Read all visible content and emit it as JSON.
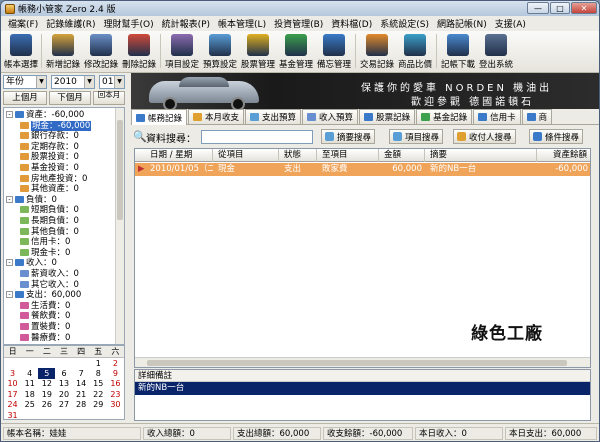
{
  "window": {
    "title": "帳務小管家 Zero 2.4 版"
  },
  "menu": [
    "檔案(F)",
    "記錄維護(R)",
    "理財幫手(O)",
    "統計報表(P)",
    "帳本管理(L)",
    "投資管理(B)",
    "資料檔(D)",
    "系統設定(S)",
    "網路記帳(N)",
    "支援(A)"
  ],
  "toolbar": [
    {
      "label": "帳本選擇",
      "icon": "ledger-icon",
      "color": "#3b6db3"
    },
    {
      "label": "新增記錄",
      "icon": "new-record-icon",
      "color": "#d6a33a"
    },
    {
      "label": "修改記錄",
      "icon": "edit-record-icon",
      "color": "#6a8fc7"
    },
    {
      "label": "刪除記錄",
      "icon": "delete-record-icon",
      "color": "#d04a3a"
    },
    {
      "label": "項目設定",
      "icon": "item-settings-icon",
      "color": "#8c6bb0"
    },
    {
      "label": "預算設定",
      "icon": "budget-settings-icon",
      "color": "#5a9ed6"
    },
    {
      "label": "股票管理",
      "icon": "stock-icon",
      "color": "#e0b020"
    },
    {
      "label": "基金管理",
      "icon": "fund-icon",
      "color": "#3ca04c"
    },
    {
      "label": "備忘管理",
      "icon": "memo-icon",
      "color": "#3a7ac8"
    },
    {
      "label": "交易記錄",
      "icon": "pencil-icon",
      "color": "#e38a2a"
    },
    {
      "label": "商品比價",
      "icon": "compare-icon",
      "color": "#3aa0c8"
    },
    {
      "label": "記帳下載",
      "icon": "download-icon",
      "color": "#4a8ad0"
    },
    {
      "label": "登出系統",
      "icon": "logout-icon",
      "color": "#5a7090"
    }
  ],
  "nav": {
    "year_label": "年份",
    "year": "2010",
    "month": "01",
    "prev_month": "上個月",
    "next_month": "下個月",
    "this_month": "回本月"
  },
  "tree": [
    {
      "text": "資產：-60,000",
      "level": 0,
      "expand": "-",
      "color": "#3a7ac8"
    },
    {
      "text": "現金：-60,000",
      "level": 1,
      "color": "#e09a3a",
      "selected": true
    },
    {
      "text": "銀行存款：0",
      "level": 1,
      "color": "#e09a3a"
    },
    {
      "text": "定期存款：0",
      "level": 1,
      "color": "#e09a3a"
    },
    {
      "text": "股票投資：0",
      "level": 1,
      "color": "#e09a3a"
    },
    {
      "text": "基金投資：0",
      "level": 1,
      "color": "#e09a3a"
    },
    {
      "text": "房地產投資：0",
      "level": 1,
      "color": "#e09a3a"
    },
    {
      "text": "其他資產：0",
      "level": 1,
      "color": "#e09a3a"
    },
    {
      "text": "負債：0",
      "level": 0,
      "expand": "-",
      "color": "#3a7ac8"
    },
    {
      "text": "短期負債：0",
      "level": 1,
      "color": "#7cb85a"
    },
    {
      "text": "長期負債：0",
      "level": 1,
      "color": "#7cb85a"
    },
    {
      "text": "其他負債：0",
      "level": 1,
      "color": "#7cb85a"
    },
    {
      "text": "信用卡：0",
      "level": 1,
      "color": "#7cb85a"
    },
    {
      "text": "現金卡：0",
      "level": 1,
      "color": "#7cb85a"
    },
    {
      "text": "收入：0",
      "level": 0,
      "expand": "-",
      "color": "#3a7ac8"
    },
    {
      "text": "薪資收入：0",
      "level": 1,
      "color": "#6a8fd0"
    },
    {
      "text": "其它收入：0",
      "level": 1,
      "color": "#6a8fd0"
    },
    {
      "text": "支出：60,000",
      "level": 0,
      "expand": "-",
      "color": "#3a7ac8"
    },
    {
      "text": "生活費：0",
      "level": 1,
      "color": "#d05a9a"
    },
    {
      "text": "餐飲費：0",
      "level": 1,
      "color": "#d05a9a"
    },
    {
      "text": "置裝費：0",
      "level": 1,
      "color": "#d05a9a"
    },
    {
      "text": "醫療費：0",
      "level": 1,
      "color": "#d05a9a"
    }
  ],
  "calendar": {
    "weekdays": [
      "日",
      "一",
      "二",
      "三",
      "四",
      "五",
      "六"
    ],
    "weeks": [
      [
        "",
        "",
        "",
        "",
        "",
        "1",
        "2"
      ],
      [
        "3",
        "4",
        "5",
        "6",
        "7",
        "8",
        "9"
      ],
      [
        "10",
        "11",
        "12",
        "13",
        "14",
        "15",
        "16"
      ],
      [
        "17",
        "18",
        "19",
        "20",
        "21",
        "22",
        "23"
      ],
      [
        "24",
        "25",
        "26",
        "27",
        "28",
        "29",
        "30"
      ],
      [
        "31",
        "",
        "",
        "",
        "",
        "",
        ""
      ]
    ],
    "today": "5"
  },
  "banner": {
    "line1": "保護你的愛車 NORDEN 機油出",
    "line2": "歡迎參觀 德國諾頓石"
  },
  "tabs": [
    {
      "label": "帳務記錄",
      "color": "#3a7ac8",
      "active": true
    },
    {
      "label": "本月收支",
      "color": "#e0a030"
    },
    {
      "label": "支出預算",
      "color": "#5a9ed6"
    },
    {
      "label": "收入預算",
      "color": "#6a8fd0"
    },
    {
      "label": "股票記錄",
      "color": "#3a7ac8"
    },
    {
      "label": "基金記錄",
      "color": "#3ca04c"
    },
    {
      "label": "信用卡",
      "color": "#3a7ac8"
    },
    {
      "label": "商",
      "color": "#3a7ac8"
    }
  ],
  "search": {
    "label": "資料搜尋：",
    "value": "",
    "buttons": [
      "摘要搜尋",
      "項目搜尋",
      "收付人搜尋",
      "條件搜尋"
    ]
  },
  "grid": {
    "columns": [
      "日期 / 星期",
      "從項目",
      "狀態",
      "至項目",
      "金額",
      "摘要",
      "資產餘額"
    ],
    "rows": [
      [
        "2010/01/05（二）",
        "現金",
        "支出",
        "敗家費",
        "60,000",
        "新的NB一台",
        "-60,000"
      ]
    ]
  },
  "watermark": "綠色工廠",
  "note": {
    "header": "詳細備註",
    "value": "新的NB一台"
  },
  "status": [
    "帳本名稱：娃娃",
    "收入總額：0",
    "支出總額：60,000",
    "收支餘額：-60,000",
    "本日收入：0",
    "本日支出：60,000"
  ]
}
